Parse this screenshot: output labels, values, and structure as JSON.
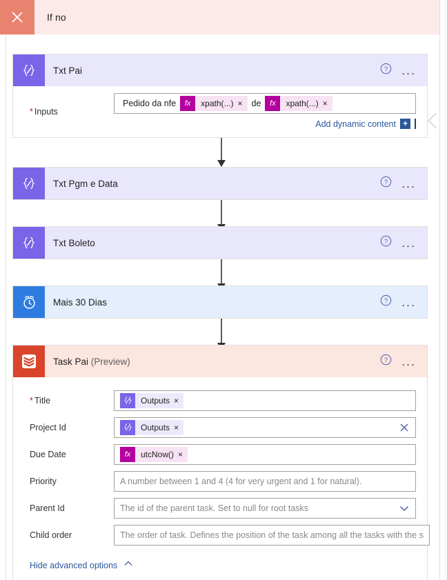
{
  "scope": {
    "title": "If no",
    "close_icon": "close-icon",
    "accent": "#e8836f",
    "background": "#fbeae7"
  },
  "icons": {
    "help": "help-icon",
    "more": "more-options-icon",
    "compose": "compose-icon",
    "delay": "alarm-clock-icon",
    "todoist": "todoist-icon",
    "clear": "clear-icon",
    "chevron_down": "chevron-down-icon",
    "chevron_up": "chevron-up-icon",
    "gutter_collapse": "collapse-chevron-icon"
  },
  "labels": {
    "more_options": "...",
    "fx": "fx",
    "token_remove": "×"
  },
  "cards": [
    {
      "name": "txt-pai",
      "title": "Txt Pai",
      "suffix": "",
      "icon": "compose-icon",
      "expanded": true,
      "fields": [
        {
          "name": "inputs",
          "label": "Inputs",
          "required": true,
          "control": "token-box",
          "parts": [
            {
              "kind": "text",
              "text": "Pedido da nfe"
            },
            {
              "kind": "token",
              "style": "fx",
              "icon": "fx",
              "label": "xpath(...)"
            },
            {
              "kind": "text",
              "text": "de"
            },
            {
              "kind": "token",
              "style": "fx",
              "icon": "fx",
              "label": "xpath(...)"
            }
          ]
        }
      ],
      "add_dynamic_content": "Add dynamic content"
    },
    {
      "name": "txt-pgm-e-data",
      "title": "Txt Pgm e Data",
      "suffix": "",
      "icon": "compose-icon",
      "expanded": false,
      "fields": []
    },
    {
      "name": "txt-boleto",
      "title": "Txt Boleto",
      "suffix": "",
      "icon": "compose-icon",
      "expanded": false,
      "fields": []
    },
    {
      "name": "mais-30-dias",
      "title": "Mais 30 Dias",
      "suffix": "",
      "icon": "alarm-clock-icon",
      "expanded": false,
      "fields": []
    },
    {
      "name": "task-pai",
      "title": "Task Pai",
      "suffix": " (Preview)",
      "icon": "todoist-icon",
      "expanded": true,
      "fields": [
        {
          "name": "title",
          "label": "Title",
          "required": true,
          "control": "token-box",
          "parts": [
            {
              "kind": "token",
              "style": "outputs",
              "icon": "compose",
              "label": "Outputs"
            }
          ]
        },
        {
          "name": "project-id",
          "label": "Project Id",
          "required": false,
          "control": "token-box",
          "button": "clear-icon",
          "parts": [
            {
              "kind": "token",
              "style": "outputs",
              "icon": "compose",
              "label": "Outputs"
            }
          ]
        },
        {
          "name": "due-date",
          "label": "Due Date",
          "required": false,
          "control": "token-box",
          "parts": [
            {
              "kind": "token",
              "style": "fx",
              "icon": "fx",
              "label": "utcNow()"
            }
          ]
        },
        {
          "name": "priority",
          "label": "Priority",
          "required": false,
          "control": "placeholder",
          "placeholder": "A number between 1 and 4 (4 for very urgent and 1 for natural)."
        },
        {
          "name": "parent-id",
          "label": "Parent Id",
          "required": false,
          "control": "placeholder",
          "button": "chevron-down-icon",
          "placeholder": "The id of the parent task. Set to null for root tasks"
        },
        {
          "name": "child-order",
          "label": "Child order",
          "required": false,
          "control": "placeholder",
          "placeholder": "The order of task. Defines the position of the task among all the tasks with the s"
        }
      ],
      "advanced_options": "Hide advanced options"
    }
  ]
}
